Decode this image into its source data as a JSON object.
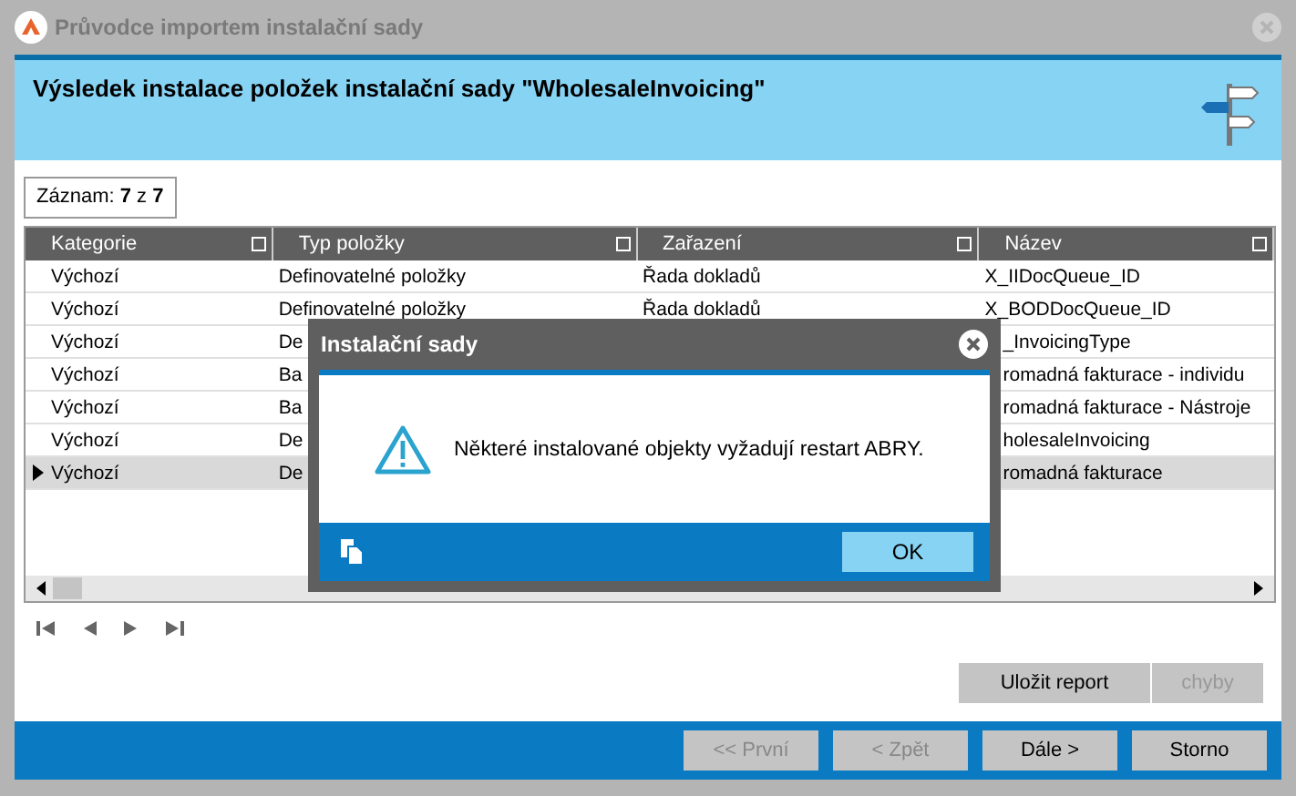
{
  "window": {
    "title": "Průvodce importem instalační sady"
  },
  "header": {
    "title": "Výsledek instalace položek instalační sady \"WholesaleInvoicing\""
  },
  "record": {
    "text": "Záznam: **7** z **7**"
  },
  "table": {
    "columns": [
      "Kategorie",
      "Typ položky",
      "Zařazení",
      "Název"
    ],
    "rows": [
      {
        "cells": [
          "Výchozí",
          "Definovatelné položky",
          "Řada dokladů",
          "X_IIDocQueue_ID"
        ],
        "selected": false
      },
      {
        "cells": [
          "Výchozí",
          "Definovatelné položky",
          "Řada dokladů",
          "X_BODDocQueue_ID"
        ],
        "selected": false
      },
      {
        "cells": [
          "Výchozí",
          "De",
          null,
          "_InvoicingType"
        ],
        "selected": false
      },
      {
        "cells": [
          "Výchozí",
          "Ba",
          null,
          "romadná fakturace - individu"
        ],
        "selected": false
      },
      {
        "cells": [
          "Výchozí",
          "Ba",
          null,
          "romadná fakturace - Nástroje"
        ],
        "selected": false
      },
      {
        "cells": [
          "Výchozí",
          "De",
          null,
          "holesaleInvoicing"
        ],
        "selected": false
      },
      {
        "cells": [
          "Výchozí",
          "De",
          null,
          "romadná fakturace"
        ],
        "selected": true
      }
    ]
  },
  "side_buttons": [
    {
      "label": "Uložit report",
      "disabled": false
    },
    {
      "label": "chyby",
      "disabled": true
    }
  ],
  "footer_buttons": [
    {
      "label": "<< První",
      "disabled": true
    },
    {
      "label": "< Zpět",
      "disabled": true
    },
    {
      "label": "Dále >",
      "disabled": false
    },
    {
      "label": "Storno",
      "disabled": false
    }
  ],
  "dialog": {
    "title": "Instalační sady",
    "message": "Některé instalované objekty vyžadují restart ABRY.",
    "button": "OK"
  }
}
